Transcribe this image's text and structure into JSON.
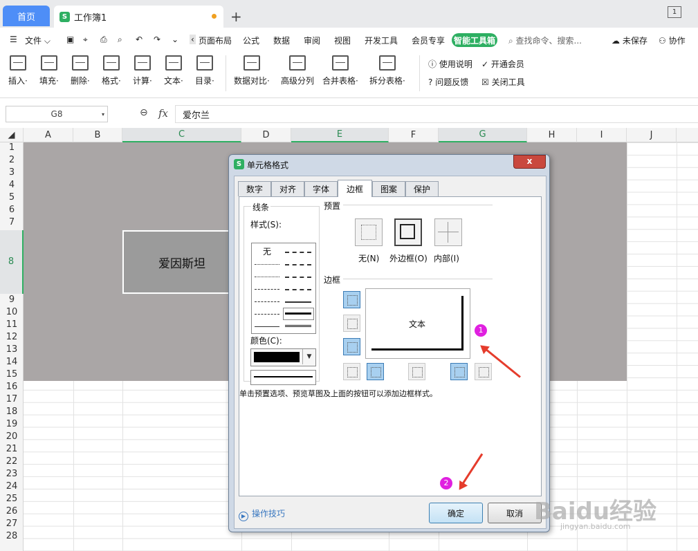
{
  "tabs": {
    "home": "首页",
    "workbook": "工作簿1",
    "add": "+"
  },
  "window": {
    "ctrl": "1"
  },
  "menu": {
    "file": "文件",
    "items": [
      "页面布局",
      "公式",
      "数据",
      "审阅",
      "视图",
      "开发工具",
      "会员专享"
    ],
    "smart": "智能工具箱",
    "search_placeholder": "查找命令、搜索...",
    "unsaved": "未保存",
    "collab": "协作"
  },
  "ribbon": {
    "buttons": [
      {
        "label": "插入·"
      },
      {
        "label": "填充·"
      },
      {
        "label": "删除·"
      },
      {
        "label": "格式·"
      },
      {
        "label": "计算·"
      },
      {
        "label": "文本·"
      },
      {
        "label": "目录·"
      },
      {
        "label": "数据对比·"
      },
      {
        "label": "高级分列"
      },
      {
        "label": "合并表格·"
      },
      {
        "label": "拆分表格·"
      }
    ],
    "links": [
      "使用说明",
      "开通会员",
      "问题反馈",
      "关闭工具"
    ]
  },
  "formula": {
    "cell_ref": "G8",
    "fx": "fx",
    "value": "爱尔兰"
  },
  "columns": [
    "A",
    "B",
    "C",
    "D",
    "E",
    "F",
    "G",
    "H",
    "I",
    "J"
  ],
  "rows": [
    "1",
    "2",
    "3",
    "4",
    "5",
    "6",
    "7",
    "8",
    "9",
    "10",
    "11",
    "12",
    "13",
    "14",
    "15",
    "16",
    "17",
    "18",
    "19",
    "20",
    "21",
    "22",
    "23",
    "24",
    "25",
    "26",
    "27",
    "28"
  ],
  "cell_c8": "爱因斯坦",
  "dialog": {
    "title": "单元格格式",
    "close": "x",
    "tabs": [
      "数字",
      "对齐",
      "字体",
      "边框",
      "图案",
      "保护"
    ],
    "active_tab": "边框",
    "line_group": "线条",
    "style_label": "样式(S):",
    "style_none": "无",
    "color_label": "颜色(C):",
    "line_color": "#000000",
    "preset_group": "预置",
    "presets": [
      "无(N)",
      "外边框(O)",
      "内部(I)"
    ],
    "border_group": "边框",
    "preview_text": "文本",
    "hint": "单击预置选项、预览草图及上面的按钮可以添加边框样式。",
    "tips": "操作技巧",
    "ok": "确定",
    "cancel": "取消"
  },
  "annotations": {
    "badge1": "1",
    "badge2": "2"
  },
  "watermark": {
    "main": "Baidu经验",
    "sub": "jingyan.baidu.com"
  }
}
